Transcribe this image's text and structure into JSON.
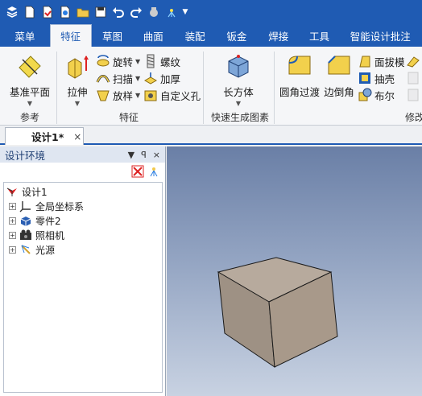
{
  "quick_access": {
    "icons": [
      "app-menu-icon",
      "new-file-icon",
      "open-file-icon",
      "import-icon",
      "folder-icon",
      "save-icon",
      "undo-icon",
      "redo-icon",
      "render-icon",
      "lighting-icon",
      "customize-dropdown-icon"
    ]
  },
  "tabs": [
    "菜单",
    "特征",
    "草图",
    "曲面",
    "装配",
    "钣金",
    "焊接",
    "工具",
    "智能设计批注"
  ],
  "active_tab": "特征",
  "ribbon": {
    "groups": {
      "reference": "参考",
      "feature": "特征",
      "quick": "快速生成图素",
      "modify": "修改"
    },
    "buttons": {
      "datum_plane": "基准平面",
      "extrude": "拉伸",
      "revolve": "旋转",
      "sweep": "扫描",
      "loft": "放样",
      "thread": "螺纹",
      "thicken": "加厚",
      "custom_hole": "自定义孔",
      "box": "长方体",
      "fillet": "圆角过渡",
      "chamfer": "边倒角",
      "face_draft": "面拔模",
      "shell": "抽壳",
      "boolean": "布尔"
    }
  },
  "document": {
    "tab_label": "设计1*",
    "close_glyph": "×"
  },
  "panel": {
    "title": "设计环境",
    "pin_glyph": "ꟼ",
    "dropdown_glyph": "▼",
    "close_glyph": "×",
    "tree": {
      "root": "设计1",
      "children": [
        "全局坐标系",
        "零件2",
        "照相机",
        "光源"
      ]
    }
  },
  "colors": {
    "ribbon_blue": "#1f5bb3",
    "viewport_top": "#6a7fa6",
    "viewport_bottom": "#c8d2e2",
    "cube_face": "#a8998a"
  }
}
